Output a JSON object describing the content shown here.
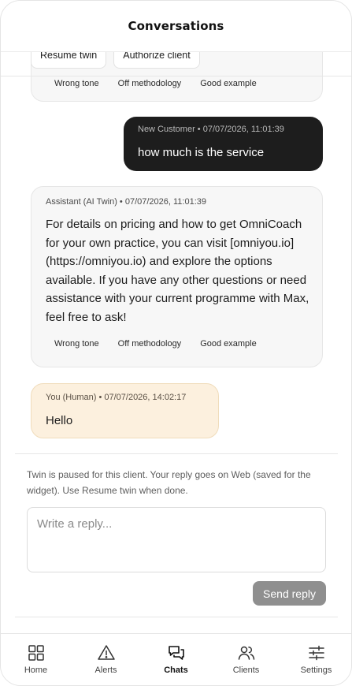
{
  "header": {
    "title": "Conversations"
  },
  "actions": {
    "resume_twin": "Resume twin",
    "authorize_client": "Authorize client"
  },
  "feedback": {
    "wrong_tone": "Wrong tone",
    "off_methodology": "Off methodology",
    "good_example": "Good example"
  },
  "messages": [
    {
      "meta": "New Customer • 07/07/2026, 11:01:39",
      "text": "how much is the service"
    },
    {
      "meta": "Assistant (AI Twin) • 07/07/2026, 11:01:39",
      "text": "For details on pricing and how to get OmniCoach for your own practice, you can visit [omniyou.io](https://omniyou.io) and explore the options available. If you have any other questions or need assistance with your current programme with Max, feel free to ask!"
    },
    {
      "meta": "You (Human) • 07/07/2026, 14:02:17",
      "text": "Hello"
    }
  ],
  "composer": {
    "notice": "Twin is paused for this client. Your reply goes on Web (saved for the widget). Use Resume twin when done.",
    "placeholder": "Write a reply...",
    "value": "",
    "send_label": "Send reply"
  },
  "nav": {
    "items": [
      {
        "label": "Home",
        "icon": "home-grid-icon"
      },
      {
        "label": "Alerts",
        "icon": "alert-triangle-icon"
      },
      {
        "label": "Chats",
        "icon": "chat-bubbles-icon",
        "active": true
      },
      {
        "label": "Clients",
        "icon": "users-icon"
      },
      {
        "label": "Settings",
        "icon": "sliders-icon"
      }
    ]
  },
  "colors": {
    "customer_bubble": "#1d1d1d",
    "assistant_bubble": "#f7f7f7",
    "human_bubble": "#fcf0de",
    "send_button": "#8f8f8f"
  }
}
